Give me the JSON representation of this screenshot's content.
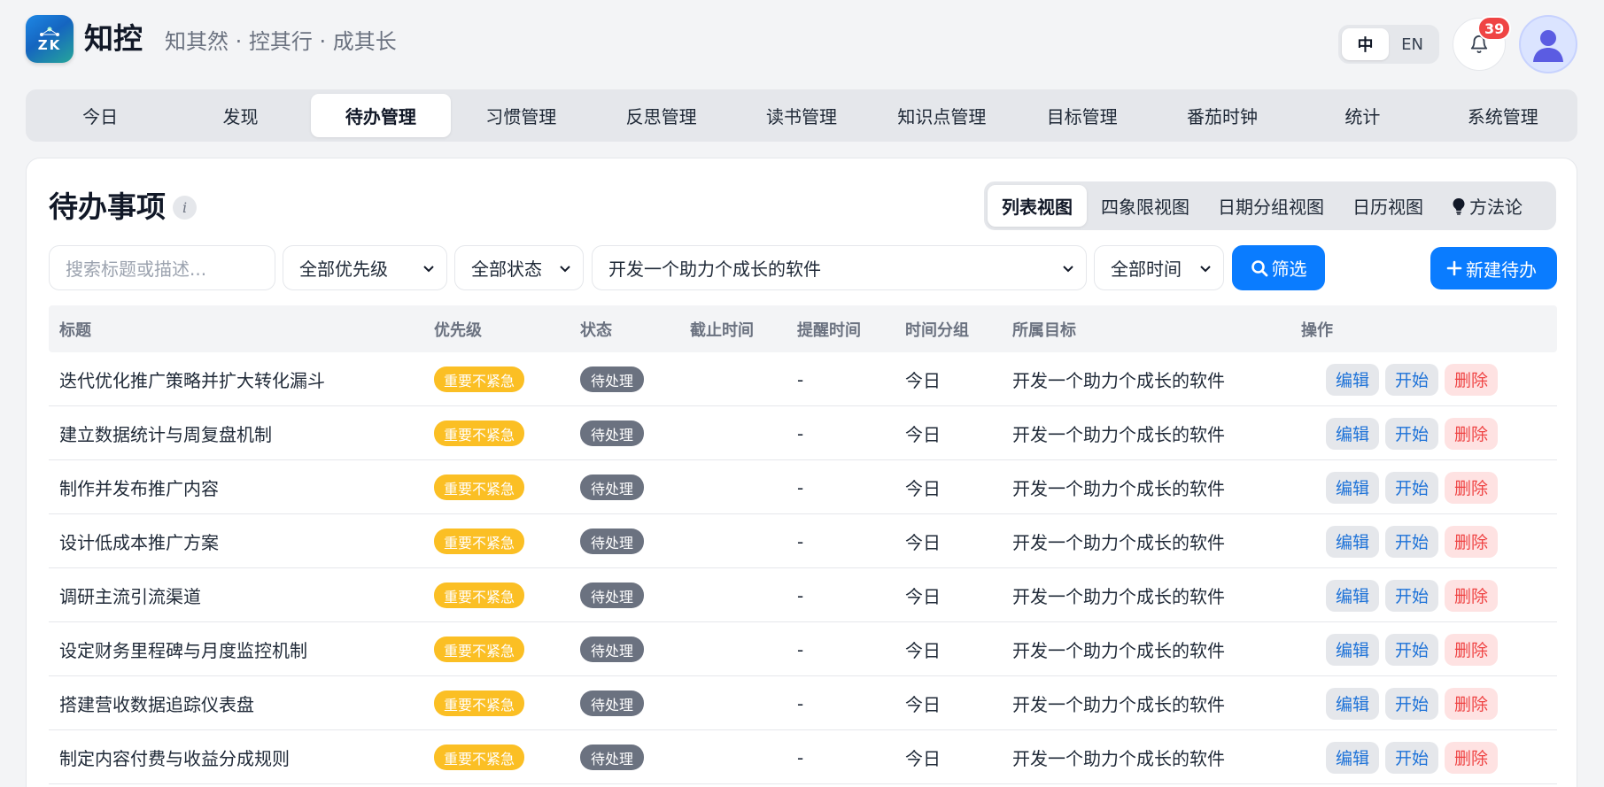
{
  "header": {
    "logo_text": "ZK",
    "brand_name": "知控",
    "slogan": "知其然 · 控其行 · 成其长",
    "lang_options": [
      "中",
      "EN"
    ],
    "lang_active": "中",
    "notification_count": "39"
  },
  "nav": {
    "items": [
      "今日",
      "发现",
      "待办管理",
      "习惯管理",
      "反思管理",
      "读书管理",
      "知识点管理",
      "目标管理",
      "番茄时钟",
      "统计",
      "系统管理"
    ],
    "active": "待办管理"
  },
  "page": {
    "title": "待办事项",
    "info_glyph": "i",
    "views": [
      "列表视图",
      "四象限视图",
      "日期分组视图",
      "日历视图",
      "方法论"
    ],
    "active_view": "列表视图"
  },
  "filters": {
    "search_placeholder": "搜索标题或描述...",
    "priority": "全部优先级",
    "status": "全部状态",
    "goal": "开发一个助力个成长的软件",
    "time": "全部时间",
    "filter_button": "筛选",
    "new_button": "新建待办"
  },
  "table": {
    "headers": [
      "标题",
      "优先级",
      "状态",
      "截止时间",
      "提醒时间",
      "时间分组",
      "所属目标",
      "操作"
    ],
    "actions": {
      "edit": "编辑",
      "start": "开始",
      "delete": "删除"
    },
    "rows": [
      {
        "title": "迭代优化推广策略并扩大转化漏斗",
        "priority": "重要不紧急",
        "status": "待处理",
        "deadline": "",
        "reminder": "-",
        "group": "今日",
        "goal": "开发一个助力个成长的软件"
      },
      {
        "title": "建立数据统计与周复盘机制",
        "priority": "重要不紧急",
        "status": "待处理",
        "deadline": "",
        "reminder": "-",
        "group": "今日",
        "goal": "开发一个助力个成长的软件"
      },
      {
        "title": "制作并发布推广内容",
        "priority": "重要不紧急",
        "status": "待处理",
        "deadline": "",
        "reminder": "-",
        "group": "今日",
        "goal": "开发一个助力个成长的软件"
      },
      {
        "title": "设计低成本推广方案",
        "priority": "重要不紧急",
        "status": "待处理",
        "deadline": "",
        "reminder": "-",
        "group": "今日",
        "goal": "开发一个助力个成长的软件"
      },
      {
        "title": "调研主流引流渠道",
        "priority": "重要不紧急",
        "status": "待处理",
        "deadline": "",
        "reminder": "-",
        "group": "今日",
        "goal": "开发一个助力个成长的软件"
      },
      {
        "title": "设定财务里程碑与月度监控机制",
        "priority": "重要不紧急",
        "status": "待处理",
        "deadline": "",
        "reminder": "-",
        "group": "今日",
        "goal": "开发一个助力个成长的软件"
      },
      {
        "title": "搭建营收数据追踪仪表盘",
        "priority": "重要不紧急",
        "status": "待处理",
        "deadline": "",
        "reminder": "-",
        "group": "今日",
        "goal": "开发一个助力个成长的软件"
      },
      {
        "title": "制定内容付费与收益分成规则",
        "priority": "重要不紧急",
        "status": "待处理",
        "deadline": "",
        "reminder": "-",
        "group": "今日",
        "goal": "开发一个助力个成长的软件"
      }
    ]
  },
  "colors": {
    "accent": "#0a7cff",
    "priority_badge": "#fbbf24",
    "status_badge": "#6b7280",
    "delete": "#ef4444",
    "notification": "#ef4444"
  },
  "icons": {
    "logo": "zk-logo-icon",
    "bell": "bell-icon",
    "avatar": "user-avatar-icon",
    "info": "info-icon",
    "bulb": "lightbulb-icon",
    "search": "search-icon",
    "plus": "plus-icon",
    "chevron": "chevron-down-icon"
  }
}
